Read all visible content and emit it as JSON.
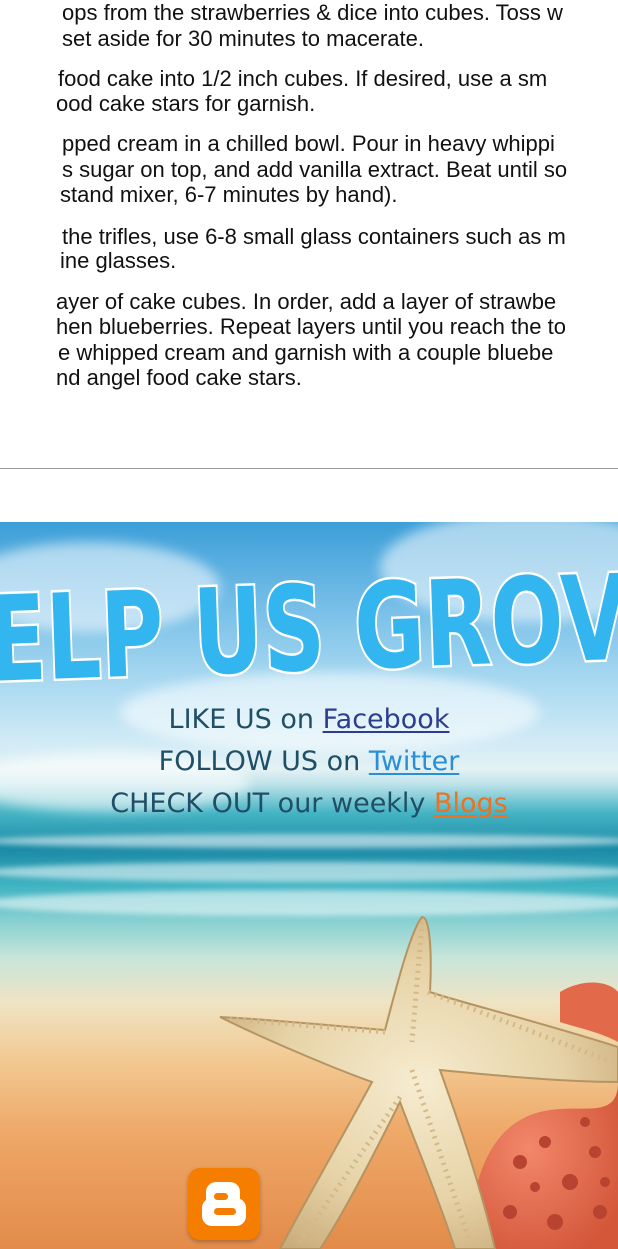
{
  "recipe": {
    "lines": [
      "ops from the strawberries & dice into cubes.  Toss w",
      "set aside for 30 minutes to macerate.",
      " food cake into 1/2 inch cubes.  If desired, use a sm",
      "ood cake stars for garnish.",
      "pped cream in a chilled bowl.  Pour in heavy whippi",
      "s sugar on top, and add vanilla extract.  Beat until so",
      "stand mixer, 6-7 minutes by hand).",
      "the trifles, use 6-8 small glass containers such as m",
      "ine glasses.",
      "ayer of cake cubes.  In order, add a layer of strawbe",
      "hen blueberries.  Repeat layers until you reach the to",
      "e whipped cream and garnish with a couple bluebe",
      "nd angel food cake stars."
    ]
  },
  "banner": {
    "title": "ELP US GROV",
    "lines": [
      {
        "prefix": "LIKE US on ",
        "link": "Facebook"
      },
      {
        "prefix": "FOLLOW US on ",
        "link": "Twitter"
      },
      {
        "prefix": "CHECK OUT our weekly ",
        "link": "Blogs"
      }
    ],
    "icons": {
      "blogger": "blogger-icon",
      "starfish": "starfish",
      "coral": "coral"
    }
  },
  "colors": {
    "title_fill": "#33b5ef",
    "title_outline": "#ffffff",
    "promo_text": "#1f4f67",
    "facebook_link": "#2c3d8f",
    "twitter_link": "#2a8fd6",
    "blogs_link": "#f0701e",
    "blogger_orange": "#f57d00",
    "divider": "#9a9a9a"
  }
}
